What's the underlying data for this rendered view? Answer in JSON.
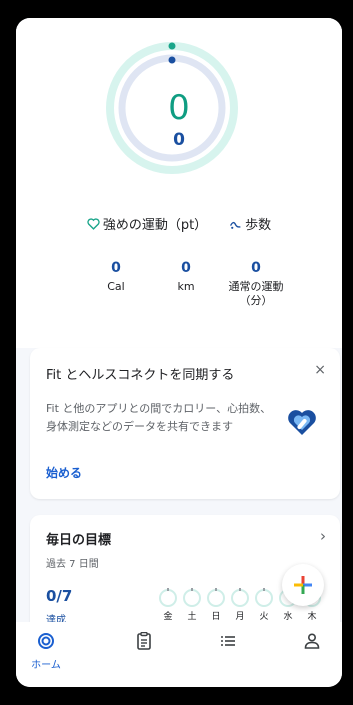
{
  "ring": {
    "main_value": "0",
    "sub_value": "0"
  },
  "legend": {
    "heart_label": "強めの運動（pt）",
    "steps_label": "歩数"
  },
  "stats": [
    {
      "value": "0",
      "label": "Cal"
    },
    {
      "value": "0",
      "label": "km"
    },
    {
      "value": "0",
      "label": "通常の運動\n（分）"
    }
  ],
  "sync_card": {
    "title": "Fit とヘルスコネクトを同期する",
    "close": "×",
    "description": "Fit と他のアプリとの間でカロリー、心拍数、身体測定などのデータを共有できます",
    "link": "始める"
  },
  "goals_card": {
    "title": "毎日の目標",
    "subtitle": "過去 7 日間",
    "count": "0/7",
    "achieved": "達成",
    "chevron": "›",
    "days": [
      "金",
      "土",
      "日",
      "月",
      "火",
      "水",
      "木"
    ]
  },
  "nav": {
    "home_label": "ホーム"
  },
  "colors": {
    "teal": "#1aa58a",
    "blue": "#1a4fa0",
    "link": "#1a5fd0"
  },
  "icons": [
    "heart-outline-icon",
    "steps-icon",
    "close-icon",
    "health-connect-logo-icon",
    "chevron-right-icon",
    "plus-icon",
    "home-ring-icon",
    "journal-icon",
    "browse-icon",
    "profile-icon"
  ]
}
